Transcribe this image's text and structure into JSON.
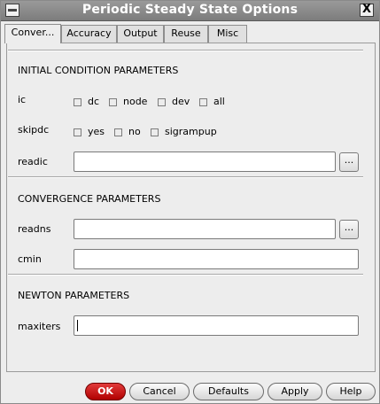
{
  "window": {
    "title": "Periodic Steady State Options",
    "close_glyph": "X"
  },
  "tabs": [
    {
      "label": "Conver...",
      "active": true
    },
    {
      "label": "Accuracy"
    },
    {
      "label": "Output"
    },
    {
      "label": "Reuse"
    },
    {
      "label": "Misc"
    }
  ],
  "initial": {
    "header": "INITIAL CONDITION PARAMETERS",
    "ic": {
      "label": "ic",
      "options": [
        "dc",
        "node",
        "dev",
        "all"
      ]
    },
    "skipdc": {
      "label": "skipdc",
      "options": [
        "yes",
        "no",
        "sigrampup"
      ]
    },
    "readic": {
      "label": "readic",
      "value": "",
      "browse": "..."
    }
  },
  "convergence": {
    "header": "CONVERGENCE PARAMETERS",
    "readns": {
      "label": "readns",
      "value": "",
      "browse": "..."
    },
    "cmin": {
      "label": "cmin",
      "value": ""
    }
  },
  "newton": {
    "header": "NEWTON PARAMETERS",
    "maxiters": {
      "label": "maxiters",
      "value": ""
    }
  },
  "buttons": {
    "ok": "OK",
    "cancel": "Cancel",
    "defaults": "Defaults",
    "apply": "Apply",
    "help": "Help"
  }
}
